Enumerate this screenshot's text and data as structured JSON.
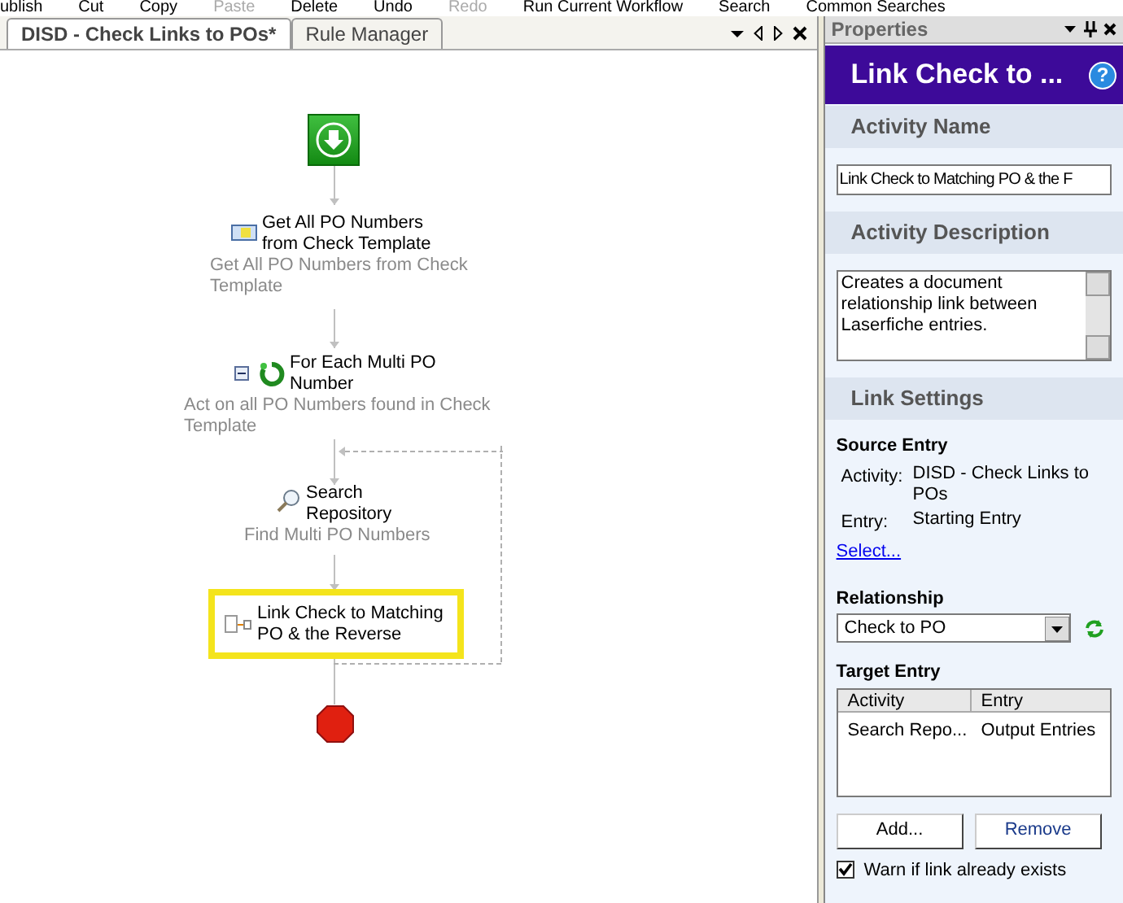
{
  "toolbar": [
    {
      "label": "ublish",
      "disabled": false
    },
    {
      "label": "Cut",
      "disabled": false
    },
    {
      "label": "Copy",
      "disabled": false
    },
    {
      "label": "Paste",
      "disabled": true
    },
    {
      "label": "Delete",
      "disabled": false
    },
    {
      "label": "Undo",
      "disabled": false
    },
    {
      "label": "Redo",
      "disabled": true
    },
    {
      "label": "Run Current Workflow",
      "disabled": false
    },
    {
      "label": "Search",
      "disabled": false
    },
    {
      "label": "Common Searches",
      "disabled": false
    }
  ],
  "tabs": [
    {
      "label": "DISD - Check Links to POs*",
      "selected": true
    },
    {
      "label": "Rule Manager",
      "selected": false
    }
  ],
  "diagram": {
    "nodes": [
      {
        "kind": "start"
      },
      {
        "kind": "condition",
        "title": "Get All PO Numbers from Check Template",
        "subtitle": "Get All PO Numbers from Check Template",
        "selected": false
      },
      {
        "kind": "loop",
        "title": "For Each Multi PO Number",
        "subtitle": "Act on all PO Numbers found in Check Template",
        "selected": false,
        "expanded": true
      },
      {
        "kind": "search",
        "title": "Search Repository",
        "subtitle": "Find Multi PO Numbers",
        "selected": false
      },
      {
        "kind": "link",
        "title": "Link Check to Matching PO & the Reverse",
        "selected": true
      },
      {
        "kind": "stop"
      }
    ]
  },
  "properties": {
    "title": "Properties",
    "header": "Link Check to ...",
    "help_label": "?",
    "activity_name": {
      "label": "Activity Name",
      "value": "Link Check to Matching PO & the F"
    },
    "activity_description": {
      "label": "Activity Description",
      "value": "Creates a document relationship link between Laserfiche entries."
    },
    "link_settings": {
      "label": "Link Settings",
      "source_entry": {
        "label": "Source Entry",
        "rows": [
          {
            "key": "Activity:",
            "value": "DISD - Check Links to POs"
          },
          {
            "key": "Entry:",
            "value": "Starting Entry"
          }
        ],
        "link": "Select..."
      },
      "relationship": {
        "label": "Relationship",
        "value": "Check to PO"
      },
      "target_entry": {
        "label": "Target Entry",
        "columns": [
          "Activity",
          "Entry"
        ],
        "rows": [
          [
            "Search Repo...",
            "Output Entries"
          ]
        ]
      },
      "buttons": [
        "Add...",
        "Remove"
      ],
      "warn": {
        "label": "Warn if link already exists",
        "checked": true
      }
    }
  }
}
